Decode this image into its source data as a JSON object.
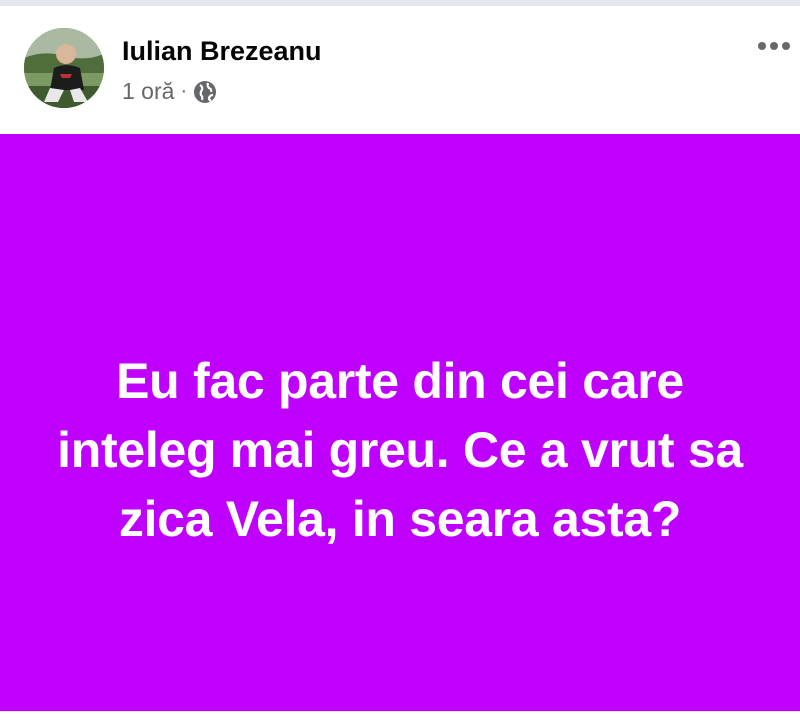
{
  "post": {
    "author": "Iulian Brezeanu",
    "time": "1 oră",
    "separator": "·",
    "privacy_icon": "globe-icon",
    "more_icon": "more-options-icon",
    "text": "Eu fac parte din cei care inteleg mai greu. Ce a vrut sa zica Vela, in seara asta?",
    "background_color": "#c000ff",
    "text_color": "#ffffff"
  }
}
